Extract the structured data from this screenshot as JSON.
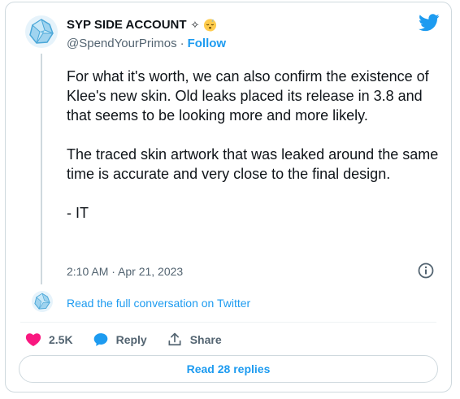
{
  "author": {
    "display_name": "SYP SIDE ACCOUNT",
    "name_decorations": "✧",
    "handle": "@SpendYourPrimos",
    "separator": "·",
    "follow_label": "Follow"
  },
  "tweet": {
    "paragraphs": [
      "For what it's worth, we can also confirm the existence of Klee's new skin. Old leaks placed its release in 3.8 and that seems to be looking more and more likely.",
      "The traced skin artwork that was leaked around the same time is accurate and very close to the final design.",
      "- IT"
    ],
    "timestamp": "2:10 AM · Apr 21, 2023"
  },
  "conversation_link": "Read the full conversation on Twitter",
  "actions": {
    "like_count": "2.5K",
    "reply_label": "Reply",
    "share_label": "Share"
  },
  "read_replies_label": "Read 28 replies",
  "icons": {
    "brand": "twitter-bird-icon",
    "heart": "heart-icon",
    "reply": "speech-bubble-icon",
    "share": "share-icon",
    "info": "info-icon",
    "emoji": "sleeping-face-emoji"
  },
  "colors": {
    "accent": "#1d9bf0",
    "like": "#f91880",
    "text": "#0f1419",
    "muted": "#536471",
    "border": "#cfd9de"
  }
}
